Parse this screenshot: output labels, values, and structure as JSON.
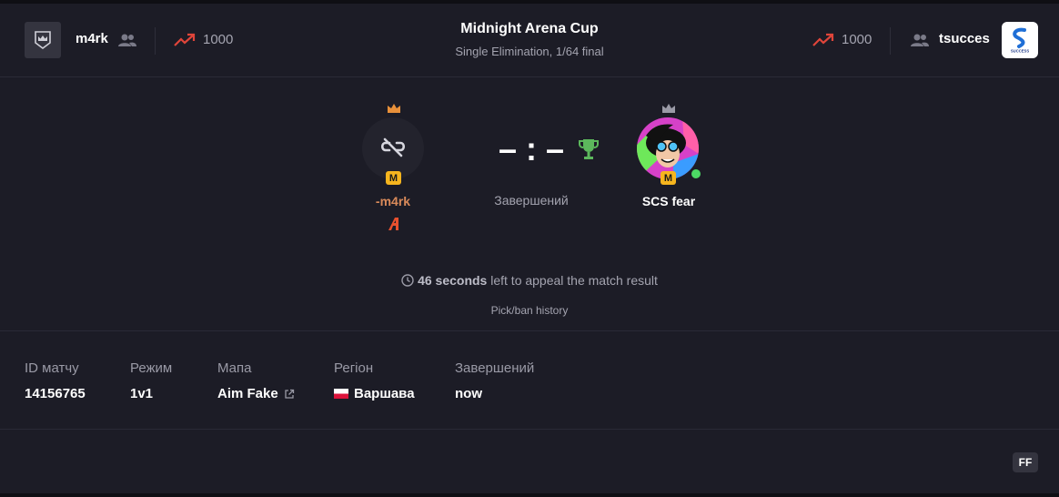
{
  "header": {
    "title": "Midnight Arena Cup",
    "subtitle": "Single Elimination, 1/64 final",
    "team_left": {
      "name": "m4rk",
      "elo": "1000"
    },
    "team_right": {
      "name": "tsucces",
      "elo": "1000",
      "logo_text": "SUCCESS"
    }
  },
  "match": {
    "player_left": {
      "name": "-m4rk",
      "level": "M"
    },
    "player_right": {
      "name": "SCS fear",
      "level": "M"
    },
    "score_left": "–",
    "score_sep": ":",
    "score_right": "–",
    "status": "Завершений",
    "appeal": {
      "seconds": "46 seconds",
      "text": " left to appeal the match result"
    },
    "pickban": "Pick/ban history"
  },
  "info": {
    "id_label": "ID матчу",
    "id_value": "14156765",
    "mode_label": "Режим",
    "mode_value": "1v1",
    "map_label": "Мапа",
    "map_value": "Aim Fake",
    "region_label": "Регіон",
    "region_value": "Варшава",
    "finished_label": "Завершений",
    "finished_value": "now"
  },
  "ff_badge": "FF",
  "colors": {
    "accent_orange": "#e8502e",
    "gold": "#f6b51e",
    "elo_red": "#e0453a",
    "trophy_green": "#5cb85c",
    "online": "#4cd964",
    "left_name": "#d98a5a"
  }
}
